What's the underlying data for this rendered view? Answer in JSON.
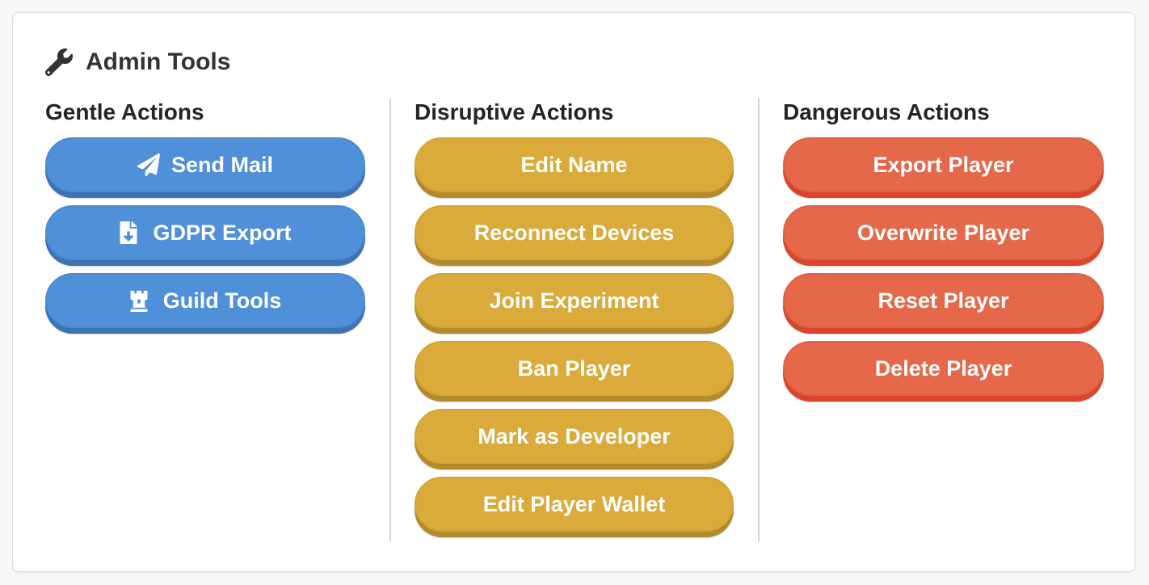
{
  "header": {
    "title": "Admin Tools",
    "icon": "wrench-icon"
  },
  "columns": [
    {
      "heading": "Gentle Actions",
      "color": "#4f90d9",
      "buttons": [
        {
          "label": "Send Mail",
          "icon": "paper-plane-icon"
        },
        {
          "label": "GDPR Export",
          "icon": "file-download-icon"
        },
        {
          "label": "Guild Tools",
          "icon": "chess-rook-icon"
        }
      ]
    },
    {
      "heading": "Disruptive Actions",
      "color": "#daaa3b",
      "buttons": [
        {
          "label": "Edit Name"
        },
        {
          "label": "Reconnect Devices"
        },
        {
          "label": "Join Experiment"
        },
        {
          "label": "Ban Player"
        },
        {
          "label": "Mark as Developer"
        },
        {
          "label": "Edit Player Wallet"
        }
      ]
    },
    {
      "heading": "Dangerous Actions",
      "color": "#e5684b",
      "buttons": [
        {
          "label": "Export Player"
        },
        {
          "label": "Overwrite Player"
        },
        {
          "label": "Reset Player"
        },
        {
          "label": "Delete Player"
        }
      ]
    }
  ]
}
